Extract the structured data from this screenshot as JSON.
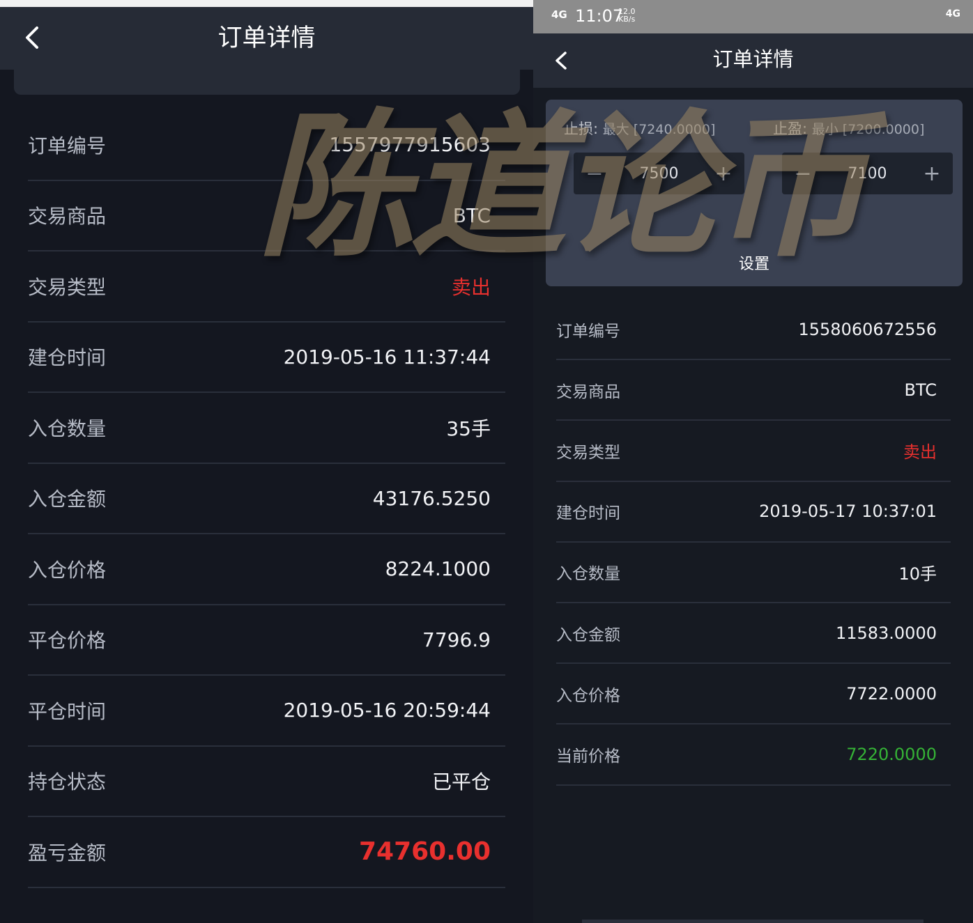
{
  "left": {
    "title": "订单详情",
    "rows": [
      {
        "label": "订单编号",
        "value": "1557977915603"
      },
      {
        "label": "交易商品",
        "value": "BTC"
      },
      {
        "label": "交易类型",
        "value": "卖出"
      },
      {
        "label": "建仓时间",
        "value": "2019-05-16 11:37:44"
      },
      {
        "label": "入仓数量",
        "value": "35手"
      },
      {
        "label": "入仓金额",
        "value": "43176.5250"
      },
      {
        "label": "入仓价格",
        "value": "8224.1000"
      },
      {
        "label": "平仓价格",
        "value": "7796.9"
      },
      {
        "label": "平仓时间",
        "value": "2019-05-16 20:59:44"
      },
      {
        "label": "持仓状态",
        "value": "已平仓"
      },
      {
        "label": "盈亏金额",
        "value": "74760.00"
      }
    ]
  },
  "right": {
    "status_bar": {
      "signal": "4G",
      "time": "11:07",
      "speed": "12.0",
      "speed_unit": "KB/s",
      "network": "4G"
    },
    "title": "订单详情",
    "stop_loss": {
      "label": "止损:",
      "range": "最大 [7240.0000]",
      "value": "7500",
      "minus": "−",
      "plus": "+"
    },
    "take_profit": {
      "label": "止盈:",
      "range": "最小 [7200.0000]",
      "value": "7100",
      "minus": "−",
      "plus": "+"
    },
    "set_button": "设置",
    "rows": [
      {
        "label": "订单编号",
        "value": "1558060672556"
      },
      {
        "label": "交易商品",
        "value": "BTC"
      },
      {
        "label": "交易类型",
        "value": "卖出"
      },
      {
        "label": "建仓时间",
        "value": "2019-05-17 10:37:01"
      },
      {
        "label": "入仓数量",
        "value": "10手"
      },
      {
        "label": "入仓金额",
        "value": "11583.0000"
      },
      {
        "label": "入仓价格",
        "value": "7722.0000"
      },
      {
        "label": "当前价格",
        "value": "7220.0000"
      }
    ]
  },
  "watermark": "陈道论币",
  "colors": {
    "sell": "#e8302e",
    "current_price": "#35b336",
    "bg": "#141720",
    "header": "#262b36"
  }
}
